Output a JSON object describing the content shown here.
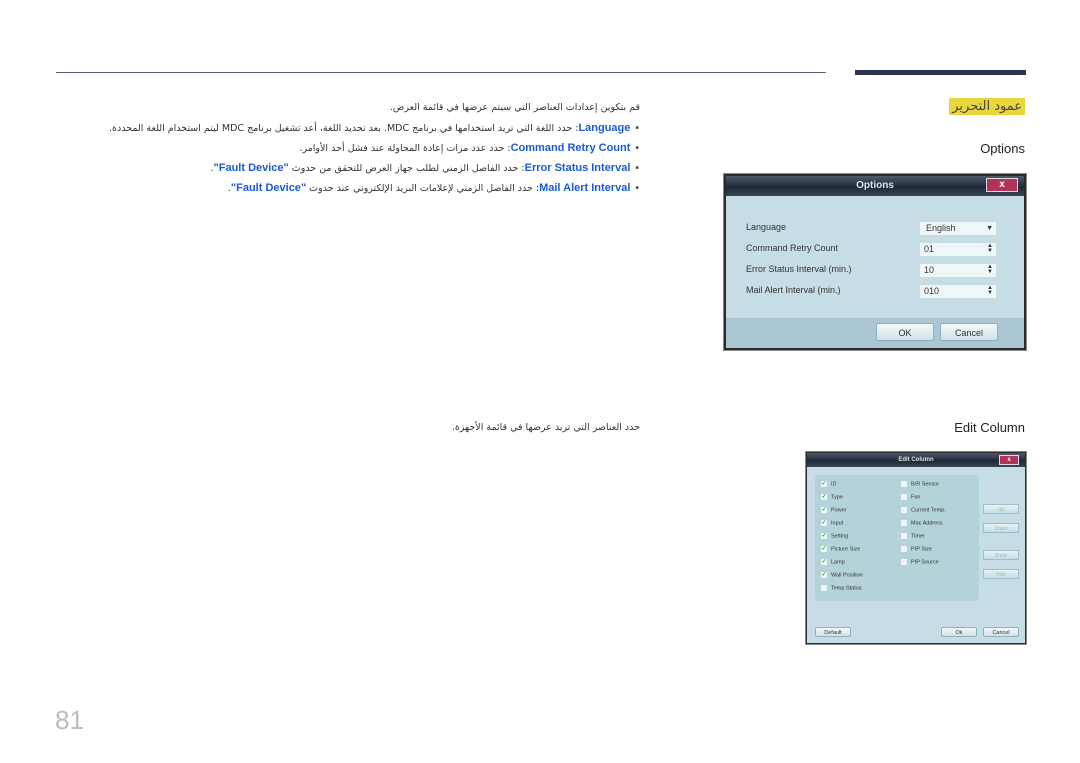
{
  "header": {
    "section_title": "عمود التحرير"
  },
  "options_section": {
    "heading": "Options",
    "intro": "قم بتكوين إعدادات العناصر التي سيتم عرضها في قائمة العرض.",
    "bullets": [
      {
        "term": "Language",
        "text": ": حدد اللغة التي تريد استخدامها في برنامج MDC. بعد تحديد اللغة، أعد تشغيل برنامج MDC ليتم استخدام اللغة المحددة."
      },
      {
        "term": "Command Retry Count",
        "text": ": حدد عدد مرات إعادة المحاولة عند فشل أحد الأوامر."
      },
      {
        "term": "Error Status Interval",
        "text": ": حدد الفاصل الزمني لطلب جهاز العرض للتحقق من حدوث ",
        "term2": "\"Fault Device\"",
        "tail": "."
      },
      {
        "term": "Mail Alert Interval",
        "text": ": حدد الفاصل الزمني لإعلامات البريد الإلكتروني عند حدوث ",
        "term2": "\"Fault Device\"",
        "tail": "."
      }
    ]
  },
  "options_dialog": {
    "title": "Options",
    "close_label": "x",
    "rows": [
      {
        "label": "Language",
        "value": "English",
        "type": "dropdown"
      },
      {
        "label": "Command Retry Count",
        "value": "01",
        "type": "spinner"
      },
      {
        "label": "Error Status Interval (min.)",
        "value": "10",
        "type": "spinner"
      },
      {
        "label": "Mail Alert Interval (min.)",
        "value": "010",
        "type": "spinner"
      }
    ],
    "ok_label": "OK",
    "cancel_label": "Cancel"
  },
  "edit_column_section": {
    "heading": "Edit Column",
    "intro": "حدد العناصر التي تريد عرضها في قائمة الأجهزة."
  },
  "edit_column_dialog": {
    "title": "Edit Column",
    "close_label": "x",
    "left_items": [
      {
        "label": "ID",
        "checked": true
      },
      {
        "label": "Type",
        "checked": true
      },
      {
        "label": "Power",
        "checked": true
      },
      {
        "label": "Input",
        "checked": true
      },
      {
        "label": "Setting",
        "checked": true
      },
      {
        "label": "Picture Size",
        "checked": true
      },
      {
        "label": "Lamp",
        "checked": true
      },
      {
        "label": "Wall Position",
        "checked": true
      },
      {
        "label": "Temp.Status",
        "checked": false
      }
    ],
    "right_items": [
      {
        "label": "B/R Sensor",
        "checked": false
      },
      {
        "label": "Fan",
        "checked": false
      },
      {
        "label": "Current Temp.",
        "checked": false
      },
      {
        "label": "Mac Address",
        "checked": false
      },
      {
        "label": "Timer",
        "checked": false
      },
      {
        "label": "PIP Size",
        "checked": false
      },
      {
        "label": "PIP Source",
        "checked": false
      }
    ],
    "side_buttons": [
      "Up",
      "Down",
      "Show",
      "Hide"
    ],
    "default_label": "Default",
    "ok_label": "Ok",
    "cancel_label": "Cancel"
  },
  "footer": {
    "page_number": "81"
  }
}
